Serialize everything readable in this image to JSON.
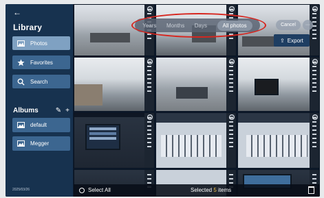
{
  "sidebar": {
    "back_glyph": "←",
    "title": "Library",
    "nav": [
      {
        "label": "Photos",
        "icon": "photo-icon",
        "active": true
      },
      {
        "label": "Favorites",
        "icon": "star-icon",
        "active": false
      },
      {
        "label": "Search",
        "icon": "search-icon",
        "active": false
      }
    ],
    "albums_title": "Albums",
    "albums": [
      {
        "label": "default",
        "icon": "album-icon"
      },
      {
        "label": "Megger",
        "icon": "album-icon"
      }
    ],
    "version": "2025/03/26"
  },
  "toolbar": {
    "segments": [
      "Years",
      "Months",
      "Days",
      "All photos"
    ],
    "selected_segment": "All photos",
    "cancel_label": "Cancel",
    "more_glyph": "···",
    "export_label": "Export",
    "export_glyph": "⇪"
  },
  "bottom_bar": {
    "select_all_label": "Select All",
    "selected_prefix": "Selected ",
    "selected_count": "5",
    "selected_suffix": " items"
  },
  "colors": {
    "sidebar_bg": "#17324f",
    "nav_active": "#7fa1c2",
    "highlight_ellipse": "#d7261f",
    "count_accent": "#f2c14a"
  }
}
